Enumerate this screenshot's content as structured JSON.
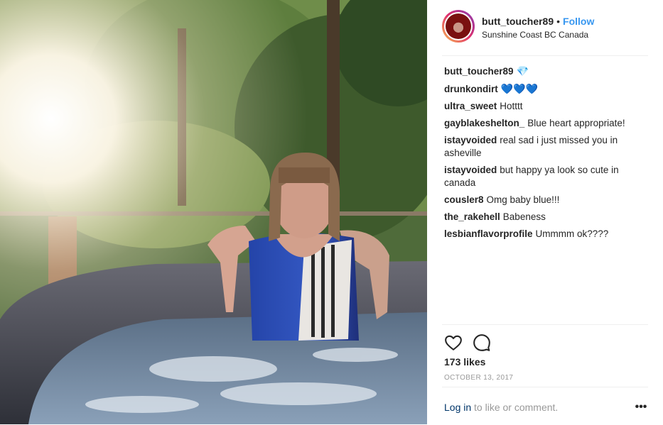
{
  "post": {
    "username": "butt_toucher89",
    "separator": "•",
    "follow_label": "Follow",
    "location": "Sunshine Coast BC Canada"
  },
  "comments": [
    {
      "user": "butt_toucher89",
      "text": "",
      "emoji": "💎"
    },
    {
      "user": "drunkondirt",
      "text": "",
      "emoji": "💙💙💙"
    },
    {
      "user": "ultra_sweet",
      "text": "Hotttt",
      "emoji": ""
    },
    {
      "user": "gayblakeshelton_",
      "text": "Blue heart appropriate!",
      "emoji": ""
    },
    {
      "user": "istayvoided",
      "text": "real sad i just missed you in asheville",
      "emoji": ""
    },
    {
      "user": "istayvoided",
      "text": "but happy ya look so cute in canada",
      "emoji": ""
    },
    {
      "user": "cousler8",
      "text": "Omg baby blue!!!",
      "emoji": ""
    },
    {
      "user": "the_rakehell",
      "text": "Babeness",
      "emoji": ""
    },
    {
      "user": "lesbianflavorprofile",
      "text": "Ummmm ok????",
      "emoji": ""
    }
  ],
  "engagement": {
    "likes": "173 likes",
    "date": "OCTOBER 13, 2017"
  },
  "footer": {
    "login_link": "Log in",
    "login_rest": " to like or comment.",
    "more_label": "•••"
  },
  "icons": {
    "like": "heart-icon",
    "comment": "comment-icon",
    "more": "more-options-icon"
  },
  "colors": {
    "link_blue": "#3897f0",
    "login_blue": "#003569",
    "emoji_blue": "#1ab5e8"
  }
}
